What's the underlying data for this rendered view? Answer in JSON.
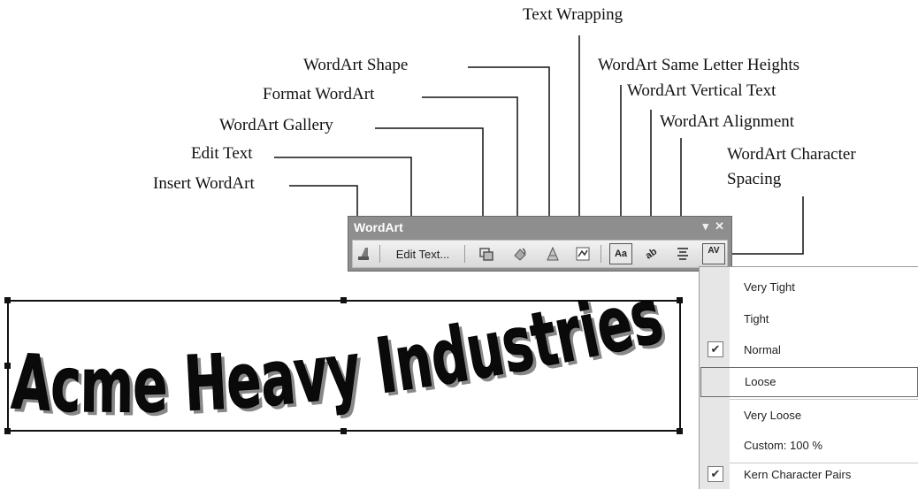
{
  "callouts": {
    "text_wrapping": "Text Wrapping",
    "wordart_shape": "WordArt Shape",
    "same_letter_heights": "WordArt Same Letter Heights",
    "format_wordart": "Format WordArt",
    "vertical_text": "WordArt Vertical Text",
    "wordart_gallery": "WordArt Gallery",
    "alignment": "WordArt Alignment",
    "edit_text": "Edit Text",
    "char_spacing_line1": "WordArt Character",
    "char_spacing_line2": "Spacing",
    "insert_wordart": "Insert WordArt"
  },
  "toolbar": {
    "title": "WordArt",
    "edit_text_label": "Edit Text...",
    "icons": [
      "insert-wordart-icon",
      "wordart-gallery-icon",
      "format-wordart-icon",
      "wordart-shape-icon",
      "text-wrapping-icon",
      "same-letter-heights-icon",
      "vertical-text-icon",
      "alignment-icon",
      "character-spacing-icon"
    ],
    "same_letter_heights_glyph": "Aa",
    "vertical_text_glyph": "ab",
    "character_spacing_glyph": "AV"
  },
  "wordart": {
    "text": "Acme Heavy Industries"
  },
  "spacing_menu": {
    "items": [
      {
        "label": "Very Tight",
        "checked": false
      },
      {
        "label": "Tight",
        "checked": false
      },
      {
        "label": "Normal",
        "checked": true
      },
      {
        "label": "Loose",
        "checked": false,
        "highlighted": true
      },
      {
        "label": "Very Loose",
        "checked": false
      },
      {
        "label": "Custom:  100 %",
        "checked": false
      },
      {
        "label": "Kern Character Pairs",
        "checked": true
      }
    ],
    "check_glyph": "✔"
  },
  "colors": {
    "toolbar_title_bar": "#8e8e8e",
    "menu_gutter": "#e6e6e6"
  }
}
